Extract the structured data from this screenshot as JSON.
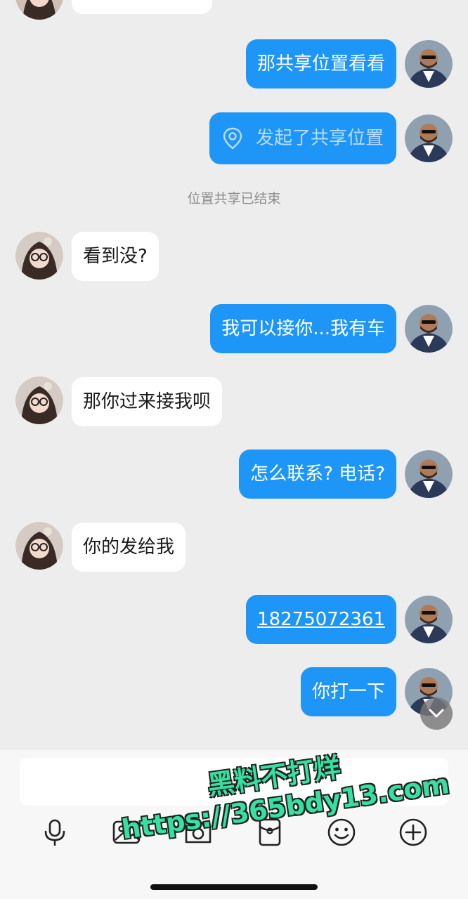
{
  "chat": {
    "partial_top_text": "...",
    "messages": [
      {
        "side": "me",
        "text": "那共享位置看看"
      },
      {
        "side": "me",
        "type": "location",
        "text": "发起了共享位置"
      },
      {
        "side": "system",
        "text": "位置共享已结束"
      },
      {
        "side": "her",
        "text": "看到没?"
      },
      {
        "side": "me",
        "text": "我可以接你...我有车"
      },
      {
        "side": "her",
        "text": "那你过来接我呗"
      },
      {
        "side": "me",
        "text": "怎么联系? 电话?"
      },
      {
        "side": "her",
        "text": "你的发给我"
      },
      {
        "side": "me",
        "type": "link",
        "text": "18275072361"
      },
      {
        "side": "me",
        "text": "你打一下"
      }
    ]
  },
  "input": {
    "value": "",
    "placeholder": ""
  },
  "toolbar": {
    "icons": [
      "microphone-icon",
      "image-icon",
      "camera-icon",
      "red-packet-icon",
      "emoji-icon",
      "plus-icon"
    ]
  },
  "watermark": {
    "line1": "黑料不打烊",
    "line2": "https://365bdy13.com"
  },
  "colors": {
    "my_bubble": "#1e96f7",
    "her_bubble": "#ffffff",
    "background": "#ededed",
    "watermark": "#35e0a1"
  }
}
